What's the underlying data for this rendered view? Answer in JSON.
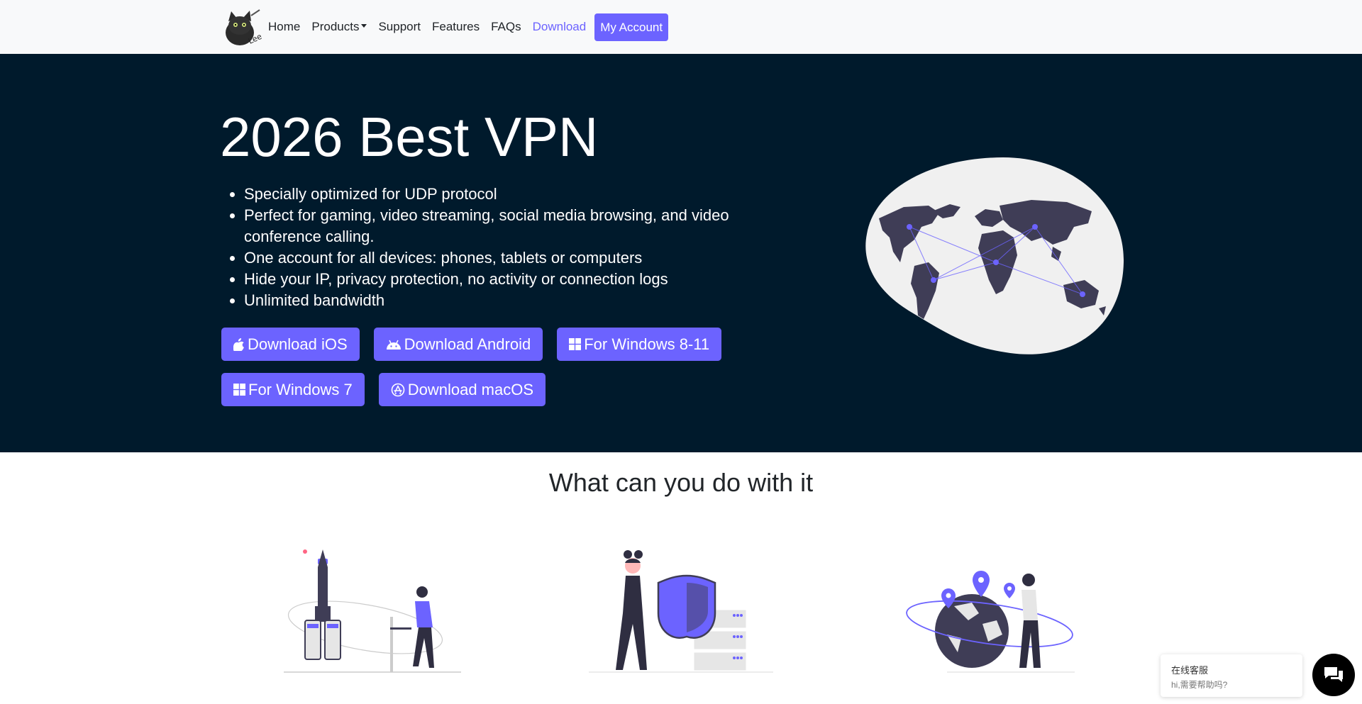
{
  "nav": {
    "items": [
      {
        "label": "Home"
      },
      {
        "label": "Products"
      },
      {
        "label": "Support"
      },
      {
        "label": "Features"
      },
      {
        "label": "FAQs"
      },
      {
        "label": "Download"
      }
    ],
    "account_label": "My Account",
    "accent_color": "#6c63ff"
  },
  "hero": {
    "title": "2026 Best VPN",
    "features": [
      "Specially optimized for UDP protocol",
      "Perfect for gaming, video streaming, social media browsing, and video conference calling.",
      "One account for all devices: phones, tablets or computers",
      "Hide your IP, privacy protection, no activity or connection logs",
      "Unlimited bandwidth"
    ],
    "buttons": [
      {
        "label": "Download iOS",
        "icon": "apple-icon"
      },
      {
        "label": "Download Android",
        "icon": "android-icon"
      },
      {
        "label": "For Windows 8-11",
        "icon": "windows-icon"
      },
      {
        "label": "For Windows 7",
        "icon": "windows-icon"
      },
      {
        "label": "Download macOS",
        "icon": "app-store-icon"
      }
    ],
    "background_color": "#001a2c"
  },
  "section": {
    "title": "What can you do with it"
  },
  "chat": {
    "title": "在线客服",
    "subtitle": "hi,需要帮助吗?"
  }
}
